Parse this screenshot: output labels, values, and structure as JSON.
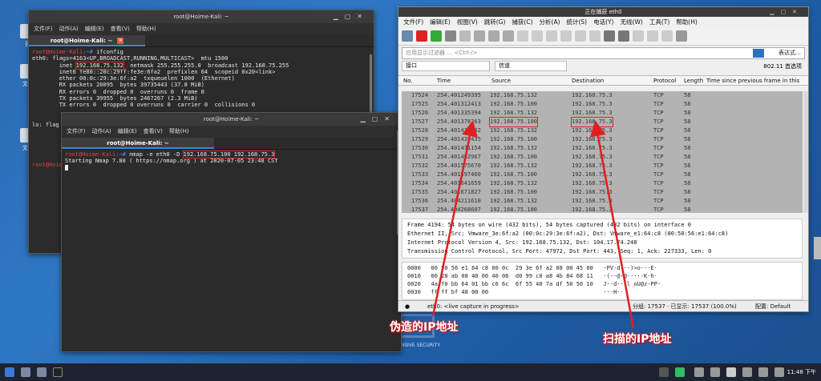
{
  "desktop": {
    "icons": [
      "回",
      "文件",
      "文件"
    ]
  },
  "term1": {
    "title": "root@Hoime-Kali: ~",
    "menu": [
      "文件(F)",
      "动作(A)",
      "编辑(E)",
      "查看(V)",
      "帮助(H)"
    ],
    "tab": "root@Hoime-Kali: ~",
    "prompt_user": "root@Hoime-Kali",
    "prompt_path": ":~#",
    "cmd": " ifconfig",
    "l1": "eth0: flags=4163<UP,BROADCAST,RUNNING,MULTICAST>  mtu 1500",
    "l2a": "        inet ",
    "ip": "192.168.75.132",
    "l2b": "  netmask 255.255.255.0  broadcast 192.168.75.255",
    "l3": "        inet6 fe80::20c:29ff:fe3e:6fa2  prefixlen 64  scopeid 0x20<link>",
    "l4": "        ether 00:0c:29:3e:6f:a2  txqueuelen 1000  (Ethernet)",
    "l5": "        RX packets 20095  bytes 39735443 (37.8 MiB)",
    "l6": "        RX errors 0  dropped 0  overruns 0  frame 0",
    "l7": "        TX packets 39955  bytes 2467267 (2.3 MiB)",
    "l8": "        TX errors 0  dropped 0 overruns 0  carrier 0  collisions 0",
    "l9": "lo: flag",
    "l10": "root@Hoime-Kali"
  },
  "term2": {
    "title": "root@Hoime-Kali: ~",
    "menu": [
      "文件(F)",
      "动作(A)",
      "编辑(E)",
      "查看(V)",
      "帮助(H)"
    ],
    "tab": "root@Hoime-Kali: ~",
    "prompt_user": "root@Hoime-Kali",
    "prompt_path": ":~#",
    "cmd": " nmap -e eth0 -D ",
    "args": "192.168.75.100 192.168.75.3",
    "out": "Starting Nmap 7.80 ( https://nmap.org ) at 2020-07-05 23:48 CST"
  },
  "ws": {
    "title": "正在捕获 eth0",
    "menu": [
      "文件(F)",
      "编辑(E)",
      "视图(V)",
      "跳转(G)",
      "捕获(C)",
      "分析(A)",
      "统计(S)",
      "电话(Y)",
      "无线(W)",
      "工具(T)",
      "帮助(H)"
    ],
    "filter_placeholder": "应用显示过滤器 … <Ctrl-/>",
    "expr": "表达式…",
    "iface_label": "接口",
    "channel_label": "信道",
    "std": "802.11 首选项",
    "cols": [
      "No.",
      "Time",
      "Source",
      "Destination",
      "Protocol",
      "Length",
      "Time since previous frame in this"
    ],
    "rows": [
      [
        "17524",
        "254.401249395",
        "192.168.75.132",
        "192.168.75.3",
        "TCP",
        "58"
      ],
      [
        "17525",
        "254.401312413",
        "192.168.75.100",
        "192.168.75.3",
        "TCP",
        "58"
      ],
      [
        "17526",
        "254.401335394",
        "192.168.75.132",
        "192.168.75.3",
        "TCP",
        "58"
      ],
      [
        "17527",
        "254.401378263",
        "192.168.75.100",
        "192.168.75.3",
        "TCP",
        "58"
      ],
      [
        "17528",
        "254.401418502",
        "192.168.75.132",
        "192.168.75.3",
        "TCP",
        "58"
      ],
      [
        "17529",
        "254.401439435",
        "192.168.75.100",
        "192.168.75.3",
        "TCP",
        "58"
      ],
      [
        "17530",
        "254.401471154",
        "192.168.75.132",
        "192.168.75.3",
        "TCP",
        "58"
      ],
      [
        "17531",
        "254.401492967",
        "192.168.75.100",
        "192.168.75.3",
        "TCP",
        "58"
      ],
      [
        "17532",
        "254.401575670",
        "192.168.75.132",
        "192.168.75.3",
        "TCP",
        "58"
      ],
      [
        "17533",
        "254.401597460",
        "192.168.75.100",
        "192.168.75.3",
        "TCP",
        "58"
      ],
      [
        "17534",
        "254.401641659",
        "192.168.75.132",
        "192.168.75.3",
        "TCP",
        "58"
      ],
      [
        "17535",
        "254.401671827",
        "192.168.75.100",
        "192.168.75.3",
        "TCP",
        "58"
      ],
      [
        "17536",
        "254.404211610",
        "192.168.75.132",
        "192.168.75.3",
        "TCP",
        "58"
      ],
      [
        "17537",
        "254.404268607",
        "192.168.75.100",
        "192.168.75.3",
        "TCP",
        "58"
      ]
    ],
    "details": [
      "Frame 4194: 54 bytes on wire (432 bits), 54 bytes captured (432 bits) on interface 0",
      "Ethernet II, Src: Vmware_3e:6f:a2 (00:0c:29:3e:6f:a2), Dst: Vmware_e1:64:c8 (00:50:56:e1:64:c8)",
      "Internet Protocol Version 4, Src: 192.168.75.132, Dst: 104.17.74.240",
      "Transmission Control Protocol, Src Port: 47972, Dst Port: 443, Seq: 1, Ack: 227333, Len: 0"
    ],
    "hex": [
      "0000   00 50 56 e1 64 c8 00 0c  29 3e 6f a2 08 00 45 00   ·PV·d···)>o···E·",
      "0010   00 28 ab 08 40 00 40 06  d0 99 c0 a8 4b 84 68 11   ·(··@·@·····K·h·",
      "0020   4a f0 bb 64 01 bb c6 6c  6f 55 40 7a df 50 50 10   J··d···l oU@z·PP·",
      "0030   ff ff bf 48 00 00                                  ···H··"
    ],
    "status_iface": "eth0: <live capture in progress>",
    "status_count": "分组: 17537 · 已显示: 17537 (100.0%)",
    "status_profile": "配置: Default"
  },
  "annotations": {
    "spoofed": "伪造的IP地址",
    "scanned": "扫描的IP地址"
  },
  "logo": "BY OFFENSIVE SECURITY",
  "taskbar": {
    "time": "11:48 下午"
  }
}
